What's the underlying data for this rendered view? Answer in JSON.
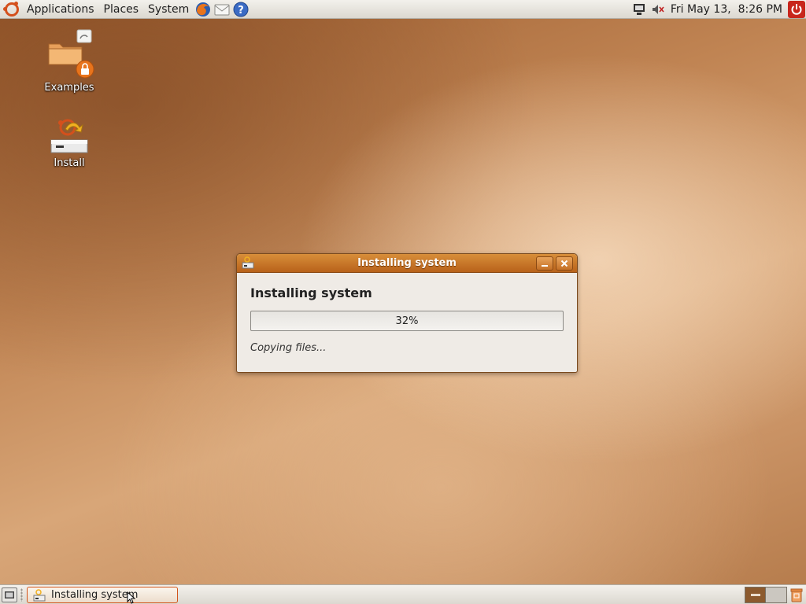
{
  "top_panel": {
    "menus": [
      "Applications",
      "Places",
      "System"
    ],
    "launchers": [
      "firefox-icon",
      "mail-icon",
      "help-icon"
    ],
    "tray_icons": [
      "network-icon",
      "volume-muted-icon",
      "shutdown-icon"
    ],
    "clock": "Fri May 13,  8:26 PM"
  },
  "desktop": {
    "icons": [
      {
        "label": "Examples",
        "icon": "folder-locked-icon"
      },
      {
        "label": "Install",
        "icon": "installer-icon"
      }
    ]
  },
  "dialog": {
    "title": "Installing system",
    "heading": "Installing system",
    "progress": {
      "percent": 32,
      "text": "32%"
    },
    "status": "Copying files..."
  },
  "bottom_panel": {
    "task_label": "Installing system",
    "workspaces": 2,
    "active_workspace": 1
  },
  "colors": {
    "accent": "#d4501c",
    "titlebar": "#c8762a",
    "progress_fill": "#e49c52"
  }
}
